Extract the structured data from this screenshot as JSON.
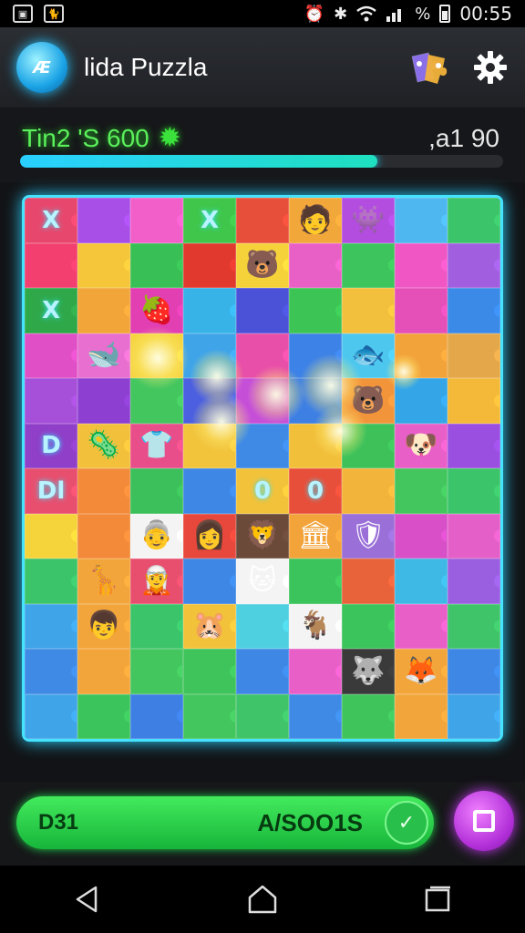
{
  "status_bar": {
    "time": "00:55",
    "battery_label": "%",
    "icons": [
      "photo-icon",
      "cat-icon",
      "alarm-icon",
      "bluetooth-icon",
      "wifi-icon",
      "signal-icon",
      "battery-icon"
    ]
  },
  "header": {
    "logo_text": "Æ",
    "title": "lida Puzzla",
    "icons": [
      "puzzle-pieces-icon",
      "gear-icon"
    ]
  },
  "score": {
    "label": "Tin2 'S 600",
    "sun_glyph": "✹",
    "value": ",a1 90",
    "progress": 0.74
  },
  "board": {
    "columns": 9,
    "rows": 12,
    "tiles": [
      {
        "c": "#e8476d",
        "g": "X"
      },
      {
        "c": "#a84fe8",
        "g": ""
      },
      {
        "c": "#f25fc9",
        "g": ""
      },
      {
        "c": "#3fc64b",
        "g": "X"
      },
      {
        "c": "#e84f3b",
        "g": ""
      },
      {
        "c": "#f2a73a",
        "g": "🧑"
      },
      {
        "c": "#b24de0",
        "g": "👾"
      },
      {
        "c": "#4fb7f0",
        "g": ""
      },
      {
        "c": "#3bc46a",
        "g": ""
      },
      {
        "c": "#f23f6f",
        "g": ""
      },
      {
        "c": "#f5c53a",
        "g": ""
      },
      {
        "c": "#38bf55",
        "g": ""
      },
      {
        "c": "#e2392f",
        "g": ""
      },
      {
        "c": "#f5d23a",
        "g": "🐻"
      },
      {
        "c": "#e85fc6",
        "g": ""
      },
      {
        "c": "#3dc45c",
        "g": ""
      },
      {
        "c": "#f057c5",
        "g": ""
      },
      {
        "c": "#a15fe0",
        "g": ""
      },
      {
        "c": "#2fa84a",
        "g": "X"
      },
      {
        "c": "#f2a539",
        "g": ""
      },
      {
        "c": "#e23fb3",
        "g": "🍓"
      },
      {
        "c": "#38b3e8",
        "g": ""
      },
      {
        "c": "#4b52d8",
        "g": ""
      },
      {
        "c": "#3cc455",
        "g": ""
      },
      {
        "c": "#f2c03c",
        "g": ""
      },
      {
        "c": "#e44fb8",
        "g": ""
      },
      {
        "c": "#3b8ae8",
        "g": ""
      },
      {
        "c": "#e04fc5",
        "g": ""
      },
      {
        "c": "#e86fd0",
        "g": "🐋"
      },
      {
        "c": "#f5d33f",
        "g": ""
      },
      {
        "c": "#3fa4e8",
        "g": ""
      },
      {
        "c": "#e84fa8",
        "g": ""
      },
      {
        "c": "#3d82e6",
        "g": ""
      },
      {
        "c": "#4ec7ef",
        "g": "🐟"
      },
      {
        "c": "#f2a33a",
        "g": ""
      },
      {
        "c": "#e4a84a",
        "g": ""
      },
      {
        "c": "#a64fd8",
        "g": ""
      },
      {
        "c": "#8c3fd0",
        "g": ""
      },
      {
        "c": "#44c65f",
        "g": ""
      },
      {
        "c": "#4b5fe0",
        "g": ""
      },
      {
        "c": "#c64fd8",
        "g": ""
      },
      {
        "c": "#3e7fe4",
        "g": ""
      },
      {
        "c": "#f2953a",
        "g": "🐻"
      },
      {
        "c": "#34a6e8",
        "g": ""
      },
      {
        "c": "#f5b93a",
        "g": ""
      },
      {
        "c": "#8f3fc8",
        "g": "D"
      },
      {
        "c": "#f2c03a",
        "g": "🦠"
      },
      {
        "c": "#e84f8a",
        "g": "👕"
      },
      {
        "c": "#f2c43c",
        "g": ""
      },
      {
        "c": "#3e8ae4",
        "g": ""
      },
      {
        "c": "#f2bf3a",
        "g": ""
      },
      {
        "c": "#3fc15a",
        "g": ""
      },
      {
        "c": "#e85fc8",
        "g": "🐶"
      },
      {
        "c": "#9a4fe0",
        "g": ""
      },
      {
        "c": "#e84f6f",
        "g": "Dl"
      },
      {
        "c": "#f28a3a",
        "g": ""
      },
      {
        "c": "#3cc05b",
        "g": ""
      },
      {
        "c": "#3e87e4",
        "g": ""
      },
      {
        "c": "#f2c23a",
        "g": "0"
      },
      {
        "c": "#e84f3a",
        "g": "0"
      },
      {
        "c": "#f2b43a",
        "g": ""
      },
      {
        "c": "#44c65f",
        "g": ""
      },
      {
        "c": "#3cc46a",
        "g": ""
      },
      {
        "c": "#f5d33a",
        "g": ""
      },
      {
        "c": "#f28a3a",
        "g": ""
      },
      {
        "c": "#f4f4f4",
        "g": "👵"
      },
      {
        "c": "#e8473b",
        "g": "👩"
      },
      {
        "c": "#6b4a3a",
        "g": "🦁"
      },
      {
        "c": "#f2a33a",
        "g": "🏛"
      },
      {
        "c": "#9a6fd8",
        "g": "🛡"
      },
      {
        "c": "#d84fc8",
        "g": ""
      },
      {
        "c": "#e45fc8",
        "g": ""
      },
      {
        "c": "#3cc46a",
        "g": ""
      },
      {
        "c": "#f2a53a",
        "g": "🦒"
      },
      {
        "c": "#e84f6f",
        "g": "🧝"
      },
      {
        "c": "#3e87e4",
        "g": ""
      },
      {
        "c": "#f4f4f4",
        "g": "🐱"
      },
      {
        "c": "#3cc45c",
        "g": ""
      },
      {
        "c": "#e8633a",
        "g": ""
      },
      {
        "c": "#3eb8e4",
        "g": ""
      },
      {
        "c": "#9a5fe0",
        "g": ""
      },
      {
        "c": "#3fa4e8",
        "g": ""
      },
      {
        "c": "#f2a53a",
        "g": "👦"
      },
      {
        "c": "#3cc46a",
        "g": ""
      },
      {
        "c": "#f2c23a",
        "g": "🐹"
      },
      {
        "c": "#4fd0e0",
        "g": ""
      },
      {
        "c": "#f4f4f4",
        "g": "🐐"
      },
      {
        "c": "#3cc45c",
        "g": ""
      },
      {
        "c": "#e85fc8",
        "g": ""
      },
      {
        "c": "#3fc46a",
        "g": ""
      },
      {
        "c": "#3e8ae4",
        "g": ""
      },
      {
        "c": "#f2a53a",
        "g": ""
      },
      {
        "c": "#44c65f",
        "g": ""
      },
      {
        "c": "#3fc45c",
        "g": ""
      },
      {
        "c": "#3e87e4",
        "g": ""
      },
      {
        "c": "#e85fc8",
        "g": ""
      },
      {
        "c": "#3a3a3a",
        "g": "🐺"
      },
      {
        "c": "#f2a53a",
        "g": "🦊"
      },
      {
        "c": "#3e87e4",
        "g": ""
      },
      {
        "c": "#3fa4e8",
        "g": ""
      },
      {
        "c": "#3cc45c",
        "g": ""
      },
      {
        "c": "#3e7fe4",
        "g": ""
      },
      {
        "c": "#44c65f",
        "g": ""
      },
      {
        "c": "#3fc46a",
        "g": ""
      },
      {
        "c": "#3e8ae4",
        "g": ""
      },
      {
        "c": "#3fc45c",
        "g": ""
      },
      {
        "c": "#f2a53a",
        "g": ""
      },
      {
        "c": "#3fa4e8",
        "g": ""
      }
    ]
  },
  "action_bar": {
    "left_text": "D31",
    "right_text": "A/SOO1S",
    "check_glyph": "✓"
  },
  "nav_bar": {
    "icons": [
      "back-icon",
      "home-icon",
      "recents-icon"
    ]
  }
}
